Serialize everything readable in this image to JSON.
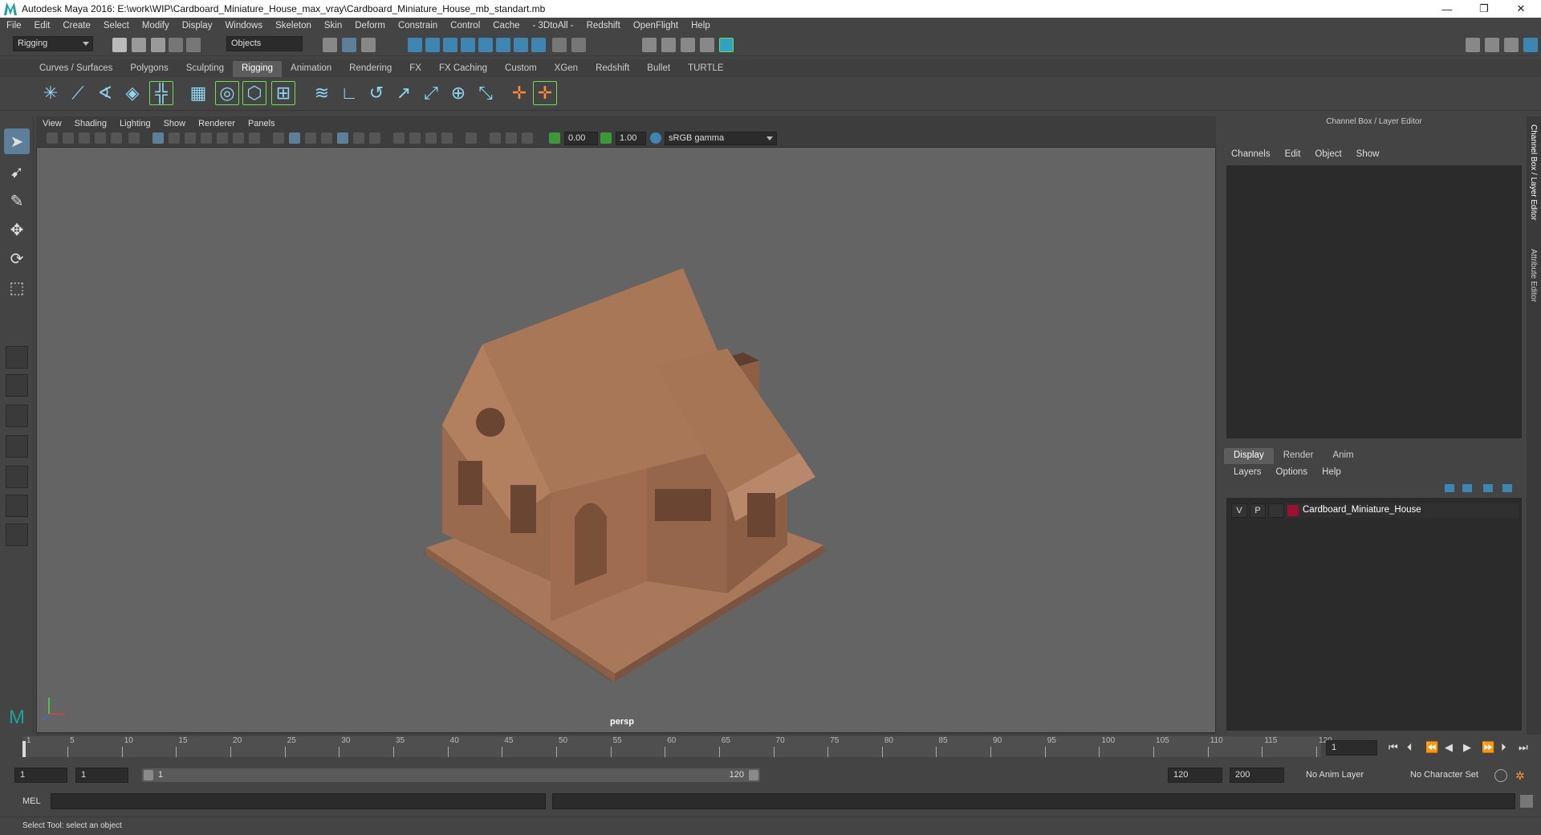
{
  "titlebar": {
    "title": "Autodesk Maya 2016: E:\\work\\WIP\\Cardboard_Miniature_House_max_vray\\Cardboard_Miniature_House_mb_standart.mb",
    "minimize": "—",
    "restore": "❐",
    "close": "✕"
  },
  "menu": [
    "File",
    "Edit",
    "Create",
    "Select",
    "Modify",
    "Display",
    "Windows",
    "Skeleton",
    "Skin",
    "Deform",
    "Constrain",
    "Control",
    "Cache",
    "- 3DtoAll -",
    "Redshift",
    "OpenFlight",
    "Help"
  ],
  "status_line": {
    "menuset": "Rigging",
    "selection_mode": "Objects"
  },
  "shelf_tabs": [
    "Curves / Surfaces",
    "Polygons",
    "Sculpting",
    "Rigging",
    "Animation",
    "Rendering",
    "FX",
    "FX Caching",
    "Custom",
    "XGen",
    "Redshift",
    "Bullet",
    "TURTLE"
  ],
  "shelf_active": "Rigging",
  "viewport": {
    "menus": [
      "View",
      "Shading",
      "Lighting",
      "Show",
      "Renderer",
      "Panels"
    ],
    "exposure": "0.00",
    "gamma": "1.00",
    "color_space": "sRGB gamma",
    "camera_label": "persp"
  },
  "channel_box": {
    "title": "Channel Box / Layer Editor",
    "menus": [
      "Channels",
      "Edit",
      "Object",
      "Show"
    ]
  },
  "layer_editor": {
    "tabs": [
      "Display",
      "Render",
      "Anim"
    ],
    "active_tab": "Display",
    "menus": [
      "Layers",
      "Options",
      "Help"
    ],
    "layers": [
      {
        "visible": "V",
        "playback": "P",
        "name": "Cardboard_Miniature_House",
        "color": "#9b1030"
      }
    ]
  },
  "side_tabs": [
    "Channel Box / Layer Editor",
    "Attribute Editor"
  ],
  "time_slider": {
    "tick_labels": [
      "1",
      "5",
      "10",
      "15",
      "20",
      "25",
      "30",
      "35",
      "40",
      "45",
      "50",
      "55",
      "60",
      "65",
      "70",
      "75",
      "80",
      "85",
      "90",
      "95",
      "100",
      "105",
      "110",
      "115",
      "120"
    ],
    "current_frame": "1"
  },
  "range_slider": {
    "start": "1",
    "playback_start": "1",
    "range_start_label": "1",
    "range_end_label": "120",
    "playback_end": "120",
    "end": "200",
    "anim_layer": "No Anim Layer",
    "character_set": "No Character Set"
  },
  "command_line": {
    "label": "MEL"
  },
  "status_bar": {
    "help_text": "Select Tool: select an object"
  }
}
